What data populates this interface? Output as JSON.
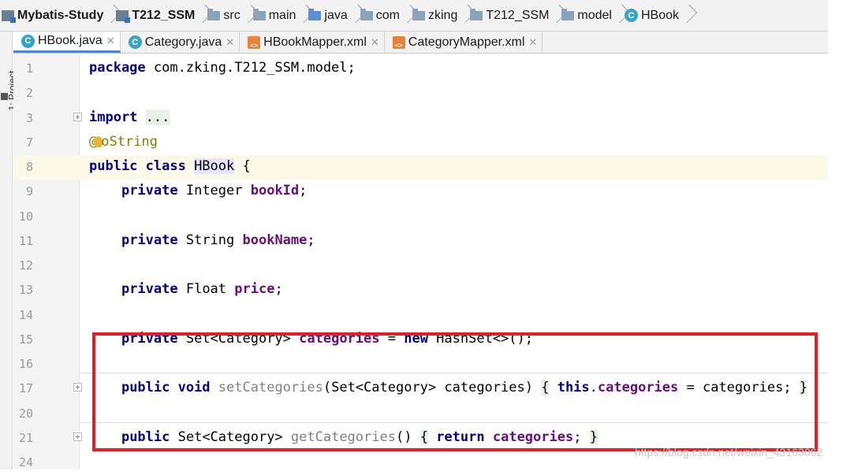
{
  "breadcrumb": {
    "items": [
      {
        "label": "Mybatis-Study",
        "icon": "module-icon",
        "bold": true
      },
      {
        "label": "T212_SSM",
        "icon": "module-folder-icon",
        "bold": true
      },
      {
        "label": "src",
        "icon": "folder-icon"
      },
      {
        "label": "main",
        "icon": "folder-icon"
      },
      {
        "label": "java",
        "icon": "source-folder-icon"
      },
      {
        "label": "com",
        "icon": "package-icon"
      },
      {
        "label": "zking",
        "icon": "package-icon"
      },
      {
        "label": "T212_SSM",
        "icon": "package-icon"
      },
      {
        "label": "model",
        "icon": "package-icon"
      },
      {
        "label": "HBook",
        "icon": "class-icon"
      }
    ]
  },
  "tabs": [
    {
      "label": "HBook.java",
      "icon": "class-icon",
      "active": true
    },
    {
      "label": "Category.java",
      "icon": "class-icon",
      "active": false
    },
    {
      "label": "HBookMapper.xml",
      "icon": "xml-icon",
      "active": false
    },
    {
      "label": "CategoryMapper.xml",
      "icon": "xml-icon",
      "active": false
    }
  ],
  "side_panel": {
    "label": "1: Project"
  },
  "editor": {
    "current_line": "8",
    "lines": [
      {
        "num": "1",
        "tokens": [
          {
            "t": "package",
            "c": "kw"
          },
          {
            "t": " com.zking.T212_SSM.model;"
          }
        ]
      },
      {
        "num": "2",
        "tokens": []
      },
      {
        "num": "3",
        "fold": true,
        "tokens": [
          {
            "t": "import",
            "c": "kw"
          },
          {
            "t": " "
          },
          {
            "t": "...",
            "c": "fold-bg"
          }
        ]
      },
      {
        "num": "7",
        "tokens": [
          {
            "t": "@",
            "c": "ann"
          },
          {
            "t": "bulb",
            "c": "bulb"
          },
          {
            "t": "oString",
            "c": "ann"
          }
        ]
      },
      {
        "num": "8",
        "tokens": [
          {
            "t": "public class ",
            "c": "kw"
          },
          {
            "t": "HBook",
            "c": "hl-cls"
          },
          {
            "t": " {"
          }
        ]
      },
      {
        "num": "9",
        "tokens": [
          {
            "t": "    "
          },
          {
            "t": "private",
            "c": "kw"
          },
          {
            "t": " Integer "
          },
          {
            "t": "bookId",
            "c": "fld"
          },
          {
            "t": ";"
          }
        ]
      },
      {
        "num": "10",
        "tokens": []
      },
      {
        "num": "11",
        "tokens": [
          {
            "t": "    "
          },
          {
            "t": "private",
            "c": "kw"
          },
          {
            "t": " String "
          },
          {
            "t": "bookName",
            "c": "fld"
          },
          {
            "t": ";"
          }
        ]
      },
      {
        "num": "12",
        "tokens": []
      },
      {
        "num": "13",
        "tokens": [
          {
            "t": "    "
          },
          {
            "t": "private",
            "c": "kw"
          },
          {
            "t": " Float "
          },
          {
            "t": "price",
            "c": "fld"
          },
          {
            "t": ";"
          }
        ]
      },
      {
        "num": "14",
        "tokens": []
      },
      {
        "num": "15",
        "tokens": [
          {
            "t": "    "
          },
          {
            "t": "private",
            "c": "kw"
          },
          {
            "t": " Set<Category> "
          },
          {
            "t": "categories",
            "c": "fld"
          },
          {
            "t": " = "
          },
          {
            "t": "new",
            "c": "kw"
          },
          {
            "t": " HashSet<>();"
          }
        ]
      },
      {
        "num": "16",
        "tokens": []
      },
      {
        "num": "17",
        "fold": true,
        "tokens": [
          {
            "t": "    "
          },
          {
            "t": "public void",
            "c": "kw"
          },
          {
            "t": " "
          },
          {
            "t": "setCategories",
            "c": "unused"
          },
          {
            "t": "(Set<Category> categories) "
          },
          {
            "t": "{",
            "c": "fold-bg"
          },
          {
            "t": " "
          },
          {
            "t": "this",
            "c": "kw"
          },
          {
            "t": "."
          },
          {
            "t": "categories",
            "c": "fld"
          },
          {
            "t": " = categories; "
          },
          {
            "t": "}",
            "c": "fold-bg"
          }
        ]
      },
      {
        "num": "20",
        "tokens": []
      },
      {
        "num": "21",
        "fold": true,
        "tokens": [
          {
            "t": "    "
          },
          {
            "t": "public",
            "c": "kw"
          },
          {
            "t": " Set<Category> "
          },
          {
            "t": "getCategories",
            "c": "unused"
          },
          {
            "t": "() "
          },
          {
            "t": "{",
            "c": "fold-bg"
          },
          {
            "t": " "
          },
          {
            "t": "return",
            "c": "kw"
          },
          {
            "t": " "
          },
          {
            "t": "categories",
            "c": "fld"
          },
          {
            "t": "; "
          },
          {
            "t": "}",
            "c": "fold-bg"
          }
        ]
      },
      {
        "num": "24",
        "tokens": []
      }
    ]
  },
  "annotation": {
    "box_color": "#e31e24"
  },
  "watermark": "https://blog.csdn.net/weixin_43163062",
  "colors": {
    "keyword": "#000080",
    "field": "#660e7a",
    "unused": "#808080",
    "annotation": "#808000"
  }
}
